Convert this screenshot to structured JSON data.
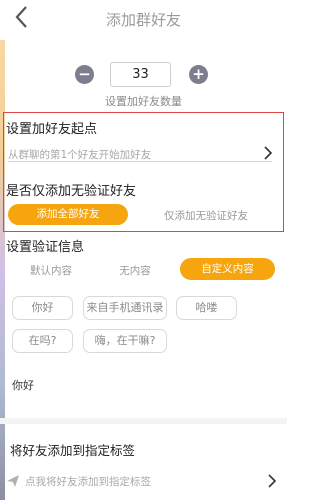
{
  "header": {
    "title": "添加群好友"
  },
  "count": {
    "value": "33",
    "minus_symbol": "−",
    "plus_symbol": "+",
    "caption": "设置加好友数量"
  },
  "start_point": {
    "title": "设置加好友起点",
    "placeholder": "从群聊的第1个好友开始加好友"
  },
  "verify_filter": {
    "title": "是否仅添加无验证好友",
    "options": [
      "添加全部好友",
      "仅添加无验证好友"
    ],
    "selected": "添加全部好友"
  },
  "verify_info": {
    "title": "设置验证信息",
    "options": [
      "默认内容",
      "无内容",
      "自定义内容"
    ],
    "selected": "自定义内容",
    "tags": [
      "你好",
      "来自手机通讯录",
      "哈喽",
      "在吗?",
      "嗨，在干嘛?"
    ],
    "message": "你好"
  },
  "label": {
    "title": "将好友添加到指定标签",
    "placeholder": "点我将好友添加到指定标签"
  },
  "colors": {
    "accent": "#f6a50f",
    "frame": "#e04545",
    "stepper": "#7a7e8e"
  }
}
